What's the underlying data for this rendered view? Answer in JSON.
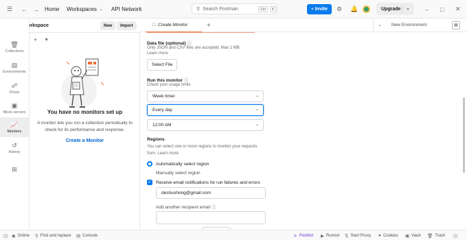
{
  "topbar": {
    "home": "Home",
    "workspaces": "Workspaces",
    "api_network": "API Network",
    "search_placeholder": "Search Postman",
    "shortcut_ctrl": "Ctrl",
    "shortcut_key": "K",
    "invite": "Invite",
    "upgrade": "Upgrade"
  },
  "workspace": {
    "title": "My Workspace",
    "new_label": "New",
    "import_label": "Import"
  },
  "rail": {
    "items": [
      {
        "label": "Collections",
        "icon": "collections-icon"
      },
      {
        "label": "Environments",
        "icon": "environments-icon"
      },
      {
        "label": "Flows",
        "icon": "flows-icon"
      },
      {
        "label": "Mock servers",
        "icon": "mock-servers-icon"
      },
      {
        "label": "Monitors",
        "icon": "monitors-icon",
        "active": true
      },
      {
        "label": "History",
        "icon": "history-icon"
      }
    ]
  },
  "sidepanel": {
    "empty_title": "You have no monitors set up",
    "empty_desc": "A monitor lets you run a collection periodically to check for its performance and response.",
    "create_link": "Create a Monitor"
  },
  "tabs": {
    "active_tab": "Create Monitor",
    "environment": "New Environment"
  },
  "form": {
    "data_file_label": "Data file (optional)",
    "data_file_hint_1": "Only JSON and CSV files are accepted. Max 1 MB.",
    "data_file_hint_2": "Learn more",
    "select_file": "Select File",
    "run_label": "Run this monitor",
    "run_hint": "Check your usage limits",
    "timer_value": "Week timer",
    "day_value": "Every day",
    "time_value": "12:00 AM",
    "regions_label": "Regions",
    "regions_hint_1": "You can select one or more regions to monitor your requests",
    "regions_hint_2": "from. Learn more",
    "auto_region": "Automatically select region",
    "manual_region": "Manually select region",
    "email_notify": "Receive email notifications for run failures and errors",
    "email_value": "deshuohong@gmail.com",
    "add_recipient": "Add another recipient email"
  },
  "statusbar": {
    "online": "Online",
    "find_replace": "Find and replace",
    "console": "Console",
    "postbot": "Postbot",
    "runner": "Runner",
    "start_proxy": "Start Proxy",
    "cookies": "Cookies",
    "vault": "Vault",
    "trash": "Trash"
  },
  "colors": {
    "accent": "#097bed",
    "tab_indicator": "#f26b3a",
    "postbot": "#6c3ad8"
  }
}
